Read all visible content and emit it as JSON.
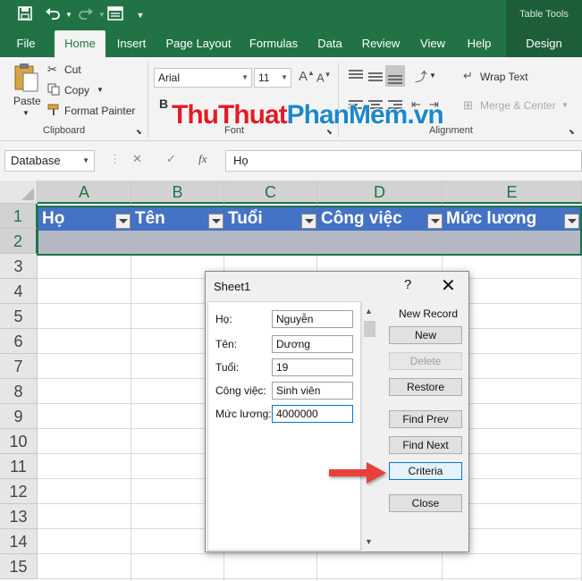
{
  "titlebar": {
    "contextual_group": "Table Tools"
  },
  "ribbon_tabs": [
    "File",
    "Home",
    "Insert",
    "Page Layout",
    "Formulas",
    "Data",
    "Review",
    "View",
    "Help",
    "Design"
  ],
  "ribbon": {
    "clipboard": {
      "paste": "Paste",
      "cut": "Cut",
      "copy": "Copy",
      "format_painter": "Format Painter",
      "label": "Clipboard"
    },
    "font": {
      "font_name": "Arial",
      "font_size": "11",
      "label": "Font",
      "bold": "B"
    },
    "alignment": {
      "wrap_text": "Wrap Text",
      "merge_center": "Merge & Center",
      "label": "Alignment"
    }
  },
  "watermark": {
    "part1": "Thu",
    "part2": "Thuat",
    "part3": "Phan",
    "part4": "Mem",
    "part5": ".vn"
  },
  "formula_bar": {
    "name_box": "Database",
    "fx": "fx",
    "content": "Họ"
  },
  "columns": [
    "A",
    "B",
    "C",
    "D",
    "E"
  ],
  "rows": [
    "1",
    "2",
    "3",
    "4",
    "5",
    "6",
    "7",
    "8",
    "9",
    "10",
    "11",
    "12",
    "13",
    "14",
    "15"
  ],
  "table_headers": [
    "Họ",
    "Tên",
    "Tuổi",
    "Công việc",
    "Mức lương"
  ],
  "dialog": {
    "title": "Sheet1",
    "help": "?",
    "close": "✕",
    "fields": [
      {
        "label": "Họ:",
        "value": "Nguyễn"
      },
      {
        "label": "Tên:",
        "value": "Dương"
      },
      {
        "label": "Tuổi:",
        "value": "19"
      },
      {
        "label": "Công việc:",
        "value": "Sinh viên"
      },
      {
        "label": "Mức lương:",
        "value": "4000000"
      }
    ],
    "record_status": "New Record",
    "buttons": {
      "new": "New",
      "delete": "Delete",
      "restore": "Restore",
      "find_prev": "Find Prev",
      "find_next": "Find Next",
      "criteria": "Criteria",
      "close": "Close"
    }
  },
  "colors": {
    "excel_green": "#217346",
    "table_header": "#4472c4",
    "arrow_red": "#e8413a"
  }
}
